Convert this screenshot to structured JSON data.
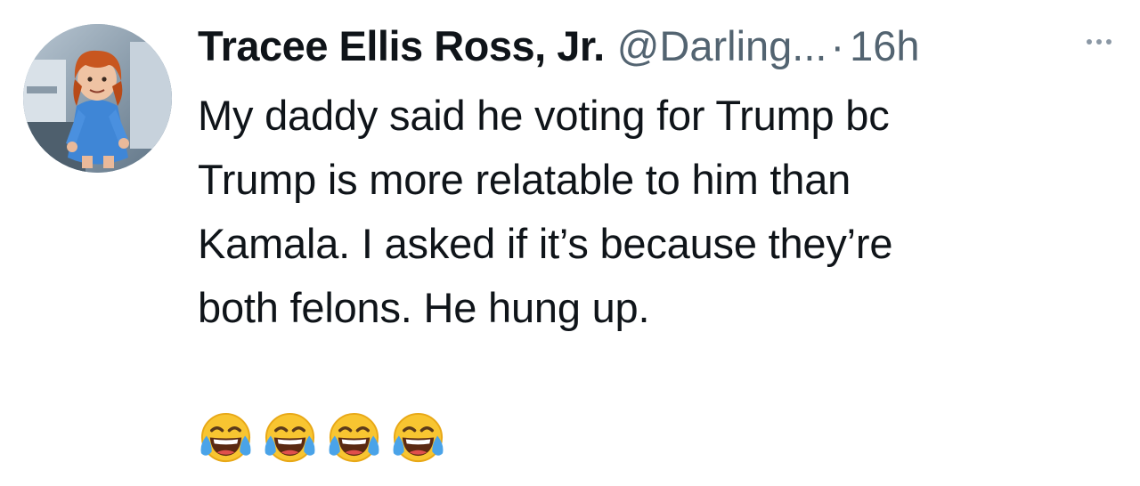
{
  "tweet": {
    "author": {
      "display_name": "Tracee Ellis Ross, Jr.",
      "handle": "@Darling...",
      "avatar_icon": "doll-avatar"
    },
    "separator": "·",
    "timestamp": "16h",
    "more_icon": "more-horizontal-icon",
    "text": "My daddy said he voting for Trump bc\nTrump is more relatable to him than\nKamala. I asked if it’s because they’re\nboth felons. He hung up.",
    "emojis": [
      "face-with-tears-of-joy",
      "face-with-tears-of-joy",
      "face-with-tears-of-joy",
      "face-with-tears-of-joy"
    ]
  },
  "colors": {
    "text_primary": "#0f1419",
    "text_secondary": "#536471",
    "more_icon": "#8b98a5"
  }
}
